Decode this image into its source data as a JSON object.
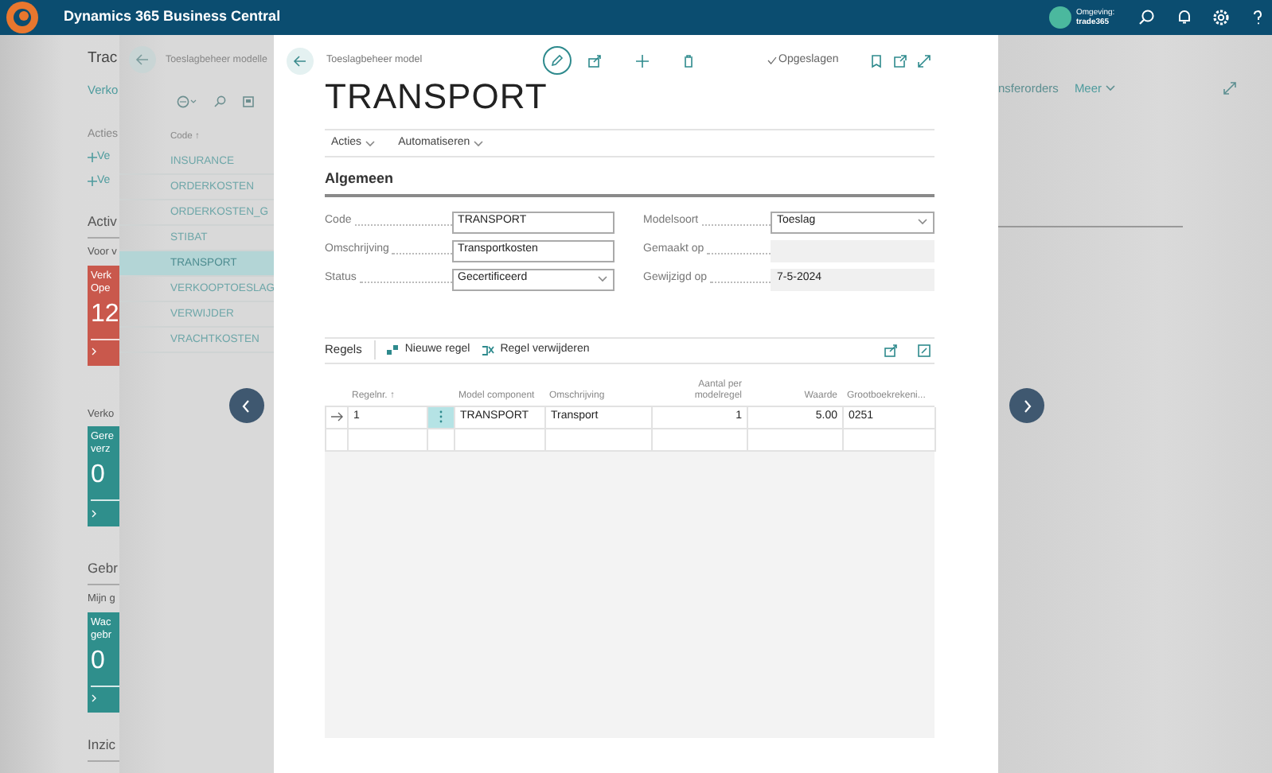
{
  "app_bar": {
    "title": "Dynamics 365 Business Central",
    "environment_label": "Omgeving:",
    "environment_name": "trade365"
  },
  "background_page": {
    "title": "Trac",
    "tab": "Verko",
    "actions_label": "Acties",
    "action_links": [
      "Ve",
      "Ve"
    ],
    "sections": [
      {
        "heading": "Activ",
        "subheading": "Voor v",
        "tiles": [
          {
            "lines": [
              "Verk",
              "Ope"
            ],
            "value": "12",
            "color": "#c9584c"
          }
        ]
      },
      {
        "subheading": "Verko",
        "tiles": [
          {
            "lines": [
              "Gere",
              "verz"
            ],
            "value": "0",
            "color": "#2f8f8c"
          }
        ]
      },
      {
        "heading": "Gebr",
        "subheading": "Mijn g",
        "tiles": [
          {
            "lines": [
              "Wac",
              "gebr"
            ],
            "value": "0",
            "color": "#2f8f8c"
          }
        ]
      },
      {
        "heading": "Inzic"
      }
    ],
    "right_links": [
      "nsferorders",
      "Meer"
    ]
  },
  "list_page": {
    "title": "Toeslagbeheer modelle",
    "column": "Code ↑",
    "items": [
      {
        "label": "INSURANCE",
        "selected": false
      },
      {
        "label": "ORDERKOSTEN",
        "selected": false
      },
      {
        "label": "ORDERKOSTEN_G",
        "selected": false
      },
      {
        "label": "STIBAT",
        "selected": false
      },
      {
        "label": "TRANSPORT",
        "selected": true
      },
      {
        "label": "VERKOOPTOESLAG",
        "selected": false
      },
      {
        "label": "VERWIJDER",
        "selected": false
      },
      {
        "label": "VRACHTKOSTEN",
        "selected": false
      }
    ]
  },
  "card": {
    "breadcrumb": "Toeslagbeheer model",
    "title": "TRANSPORT",
    "save_status": "Opgeslagen",
    "menu": [
      "Acties",
      "Automatiseren"
    ],
    "general": {
      "heading": "Algemeen",
      "fields": [
        {
          "label": "Code",
          "value": "TRANSPORT",
          "kind": "text"
        },
        {
          "label": "Modelsoort",
          "value": "Toeslag",
          "kind": "dropdown"
        },
        {
          "label": "Omschrijving",
          "value": "Transportkosten",
          "kind": "text"
        },
        {
          "label": "Gemaakt op",
          "kind": "readonly"
        },
        {
          "label": "Status",
          "value": "Gecertificeerd",
          "kind": "dropdown"
        },
        {
          "label": "Gewijzigd op",
          "value": "7-5-2024",
          "kind": "readonly"
        }
      ]
    },
    "lines": {
      "heading": "Regels",
      "actions": [
        "Nieuwe regel",
        "Regel verwijderen"
      ],
      "columns": [
        {
          "label": "Regelnr. ↑",
          "kind": "text"
        },
        {
          "label": "Model component",
          "kind": "text"
        },
        {
          "label": "Omschrijving",
          "kind": "text"
        },
        {
          "label": "Aantal per modelregel",
          "kind": "number"
        },
        {
          "label": "Waarde",
          "kind": "number"
        },
        {
          "label": "Grootboekrekeni...",
          "kind": "text"
        }
      ],
      "rows": [
        {
          "selected": true,
          "cells": [
            "1",
            "TRANSPORT",
            "Transport",
            "1",
            "5.00",
            "0251"
          ]
        }
      ]
    }
  }
}
